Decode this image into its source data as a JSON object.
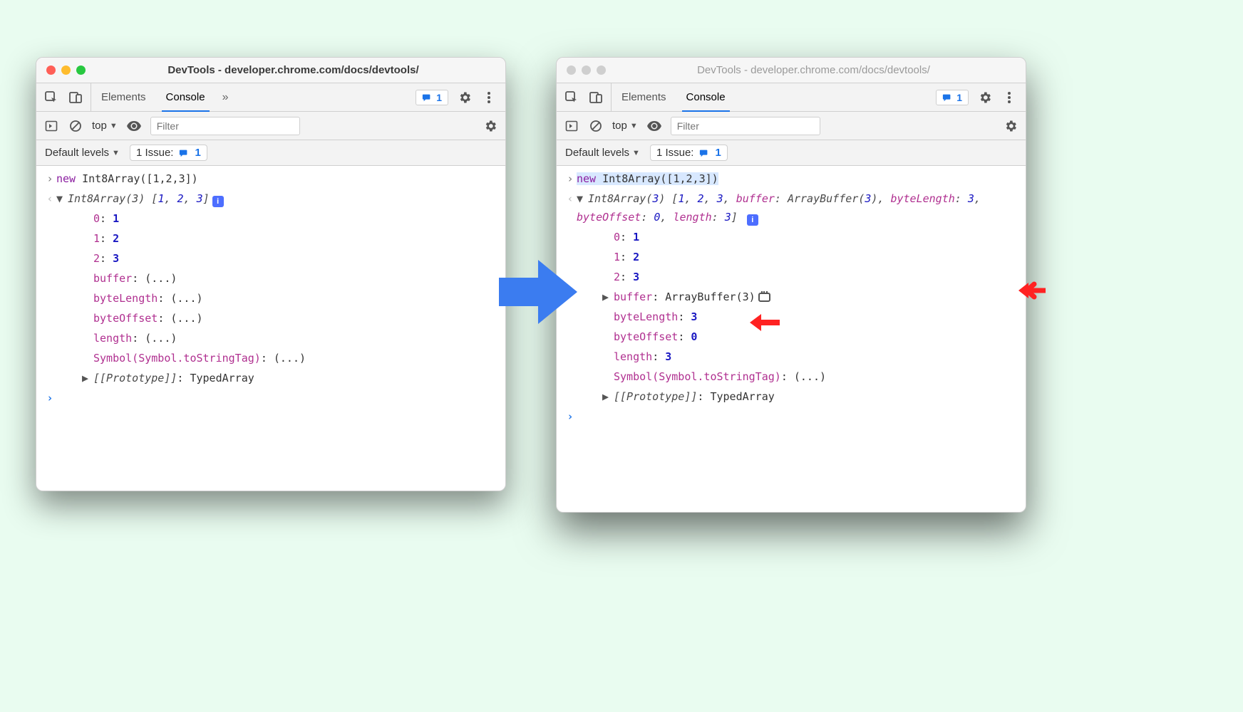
{
  "windowTitle": "DevTools - developer.chrome.com/docs/devtools/",
  "tabs": {
    "elements": "Elements",
    "console": "Console",
    "more": "»"
  },
  "issuesBadge": "1",
  "subbar": {
    "context": "top",
    "filterPlaceholder": "Filter"
  },
  "subbar2": {
    "levels": "Default levels",
    "issueLabel": "1 Issue:",
    "issueCount": "1"
  },
  "input": {
    "kw": "new",
    "rest": " Int8Array([1,2,3])"
  },
  "left": {
    "preview": {
      "head": "Int8Array(3) ",
      "vals": [
        "1",
        "2",
        "3"
      ]
    },
    "props": [
      {
        "k": "0",
        "v": "1",
        "vnum": true
      },
      {
        "k": "1",
        "v": "2",
        "vnum": true
      },
      {
        "k": "2",
        "v": "3",
        "vnum": true
      },
      {
        "k": "buffer",
        "v": "(...)"
      },
      {
        "k": "byteLength",
        "v": "(...)"
      },
      {
        "k": "byteOffset",
        "v": "(...)"
      },
      {
        "k": "length",
        "v": "(...)"
      },
      {
        "k": "Symbol(Symbol.toStringTag)",
        "v": "(...)"
      }
    ],
    "proto": {
      "k": "[[Prototype]]",
      "v": "TypedArray"
    }
  },
  "right": {
    "previewFull": "Int8Array(3) [1, 2, 3, buffer: ArrayBuffer(3), byteLength: 3, byteOffset: 0, length: 3]",
    "props": [
      {
        "k": "0",
        "v": "1",
        "vnum": true
      },
      {
        "k": "1",
        "v": "2",
        "vnum": true
      },
      {
        "k": "2",
        "v": "3",
        "vnum": true
      }
    ],
    "buffer": {
      "k": "buffer",
      "v": "ArrayBuffer(3)"
    },
    "props2": [
      {
        "k": "byteLength",
        "v": "3",
        "vnum": true
      },
      {
        "k": "byteOffset",
        "v": "0",
        "vnum": true
      },
      {
        "k": "length",
        "v": "3",
        "vnum": true
      },
      {
        "k": "Symbol(Symbol.toStringTag)",
        "v": "(...)"
      }
    ],
    "proto": {
      "k": "[[Prototype]]",
      "v": "TypedArray"
    }
  }
}
